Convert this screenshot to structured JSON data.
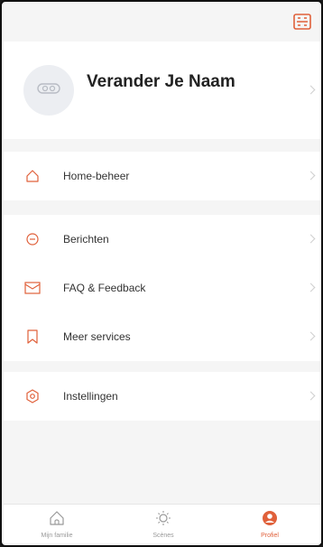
{
  "colors": {
    "accent": "#e0603a",
    "background": "#f5f5f5",
    "card": "#ffffff"
  },
  "header": {
    "scan_icon": "scan-icon"
  },
  "profile": {
    "name": "Verander Je Naam",
    "avatar_icon": "avatar-icon"
  },
  "menu": {
    "home": {
      "label": "Home-beheer",
      "icon": "house-icon"
    },
    "messages": {
      "label": "Berichten",
      "icon": "chat-icon"
    },
    "faq": {
      "label": "FAQ & Feedback",
      "icon": "mail-icon"
    },
    "services": {
      "label": "Meer services",
      "icon": "bookmark-icon"
    },
    "settings": {
      "label": "Instellingen",
      "icon": "settings-icon"
    }
  },
  "tabbar": {
    "tabs": [
      {
        "label": "Mijn familie",
        "icon": "home-icon",
        "active": false
      },
      {
        "label": "Scènes",
        "icon": "sun-icon",
        "active": false
      },
      {
        "label": "Profiel",
        "icon": "profile-icon",
        "active": true
      }
    ]
  }
}
